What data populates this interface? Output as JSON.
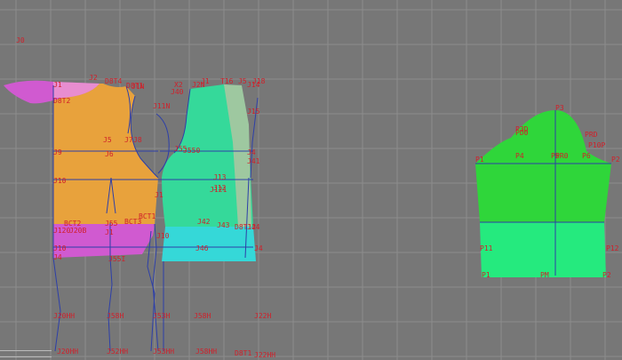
{
  "colors": {
    "background": "#777777",
    "grid": "#8c8c8c",
    "construction_line": "#2d3fa8",
    "label": "#d0202a",
    "front_bodice": "#e8a23c",
    "front_band": "#d05ad0",
    "collar": "#d05ad0",
    "back_bodice": "#35d99a",
    "back_panel": "#9ec8a0",
    "back_band": "#35d8d8",
    "sleeve_top": "#2fd63a",
    "sleeve_band": "#25ea7e"
  },
  "labels": [
    {
      "id": "J0",
      "text": "J0"
    },
    {
      "id": "J1a",
      "text": "J1"
    },
    {
      "id": "J2",
      "text": "J2"
    },
    {
      "id": "D8T4",
      "text": "D8T4"
    },
    {
      "id": "D8T1",
      "text": "D8T1"
    },
    {
      "id": "D8T2",
      "text": "D8T2"
    },
    {
      "id": "J5",
      "text": "J5"
    },
    {
      "id": "J6",
      "text": "J6"
    },
    {
      "id": "J7",
      "text": "J7"
    },
    {
      "id": "J8",
      "text": "J8"
    },
    {
      "id": "J9",
      "text": "J9"
    },
    {
      "id": "J10",
      "text": "J10"
    },
    {
      "id": "J14",
      "text": "J14"
    },
    {
      "id": "J15",
      "text": "J15"
    },
    {
      "id": "J1N",
      "text": "J1N"
    },
    {
      "id": "J11N",
      "text": "J11N"
    },
    {
      "id": "J40",
      "text": "J40"
    },
    {
      "id": "X2",
      "text": "X2"
    },
    {
      "id": "J2N",
      "text": "J2N"
    },
    {
      "id": "T16",
      "text": "T16"
    },
    {
      "id": "J1b",
      "text": "J1"
    },
    {
      "id": "J5b",
      "text": "J5"
    },
    {
      "id": "J18",
      "text": "J18"
    },
    {
      "id": "J55",
      "text": "J55"
    },
    {
      "id": "J550",
      "text": "J550"
    },
    {
      "id": "BCT1",
      "text": "BCT1"
    },
    {
      "id": "BCT2",
      "text": "BCT2"
    },
    {
      "id": "BCT3",
      "text": "BCT3"
    },
    {
      "id": "J1b2",
      "text": "J1"
    },
    {
      "id": "J120",
      "text": "J120"
    },
    {
      "id": "J20B",
      "text": "J20B"
    },
    {
      "id": "J13",
      "text": "J13"
    },
    {
      "id": "J12",
      "text": "J12"
    },
    {
      "id": "J121",
      "text": "J121"
    },
    {
      "id": "J4",
      "text": "J4"
    },
    {
      "id": "J41",
      "text": "J41"
    },
    {
      "id": "J42",
      "text": "J42"
    },
    {
      "id": "J43",
      "text": "J43"
    },
    {
      "id": "J44",
      "text": "J44"
    },
    {
      "id": "J46",
      "text": "J46"
    },
    {
      "id": "J55b",
      "text": "J55"
    },
    {
      "id": "J55I",
      "text": "J55I"
    },
    {
      "id": "J1b3",
      "text": "J1"
    },
    {
      "id": "J20HH",
      "text": "J20HH"
    },
    {
      "id": "J58H",
      "text": "J58H"
    },
    {
      "id": "J53H",
      "text": "J53H"
    },
    {
      "id": "J58H2",
      "text": "J58H"
    },
    {
      "id": "J22H",
      "text": "J22H"
    },
    {
      "id": "J20HH2",
      "text": "J20HH"
    },
    {
      "id": "J52HH",
      "text": "J52HH"
    },
    {
      "id": "J53HH",
      "text": "J53HH"
    },
    {
      "id": "J58HH",
      "text": "J58HH"
    },
    {
      "id": "D8T1b",
      "text": "D8T1"
    },
    {
      "id": "J22HH",
      "text": "J22HH"
    },
    {
      "id": "D8T12",
      "text": "D8T12"
    },
    {
      "id": "J10b",
      "text": "J10"
    },
    {
      "id": "J10a",
      "text": "J10"
    },
    {
      "id": "J4b",
      "text": "J4"
    },
    {
      "id": "J4a",
      "text": "J4"
    },
    {
      "id": "P3",
      "text": "P3"
    },
    {
      "id": "P1",
      "text": "P1"
    },
    {
      "id": "P2",
      "text": "P2"
    },
    {
      "id": "P4",
      "text": "P4"
    },
    {
      "id": "P5",
      "text": "P5"
    },
    {
      "id": "P6",
      "text": "P6"
    },
    {
      "id": "P3D",
      "text": "P3D"
    },
    {
      "id": "PD0",
      "text": "PD0"
    },
    {
      "id": "PRD",
      "text": "PRD"
    },
    {
      "id": "PR0",
      "text": "PR0"
    },
    {
      "id": "P10P",
      "text": "P10P"
    },
    {
      "id": "P11",
      "text": "P11"
    },
    {
      "id": "P12",
      "text": "P12"
    },
    {
      "id": "P2b",
      "text": "P2"
    },
    {
      "id": "P1b",
      "text": "P1"
    },
    {
      "id": "PM",
      "text": "PM"
    }
  ]
}
